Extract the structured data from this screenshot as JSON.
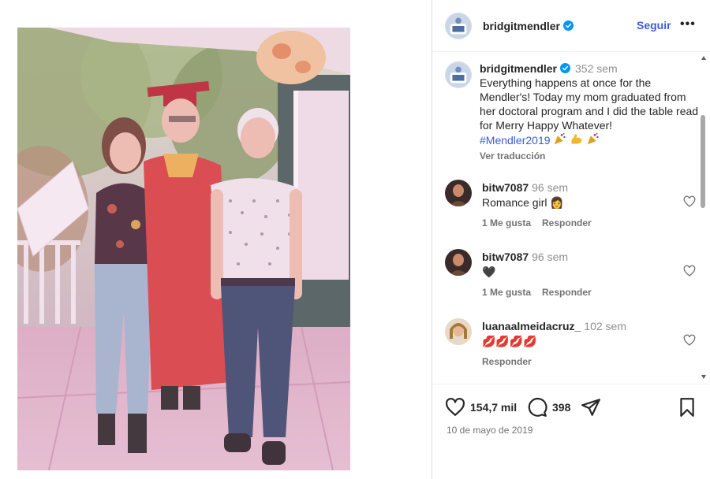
{
  "post": {
    "username": "bridgitmendler",
    "verified": true,
    "follow_label": "Seguir",
    "more_label": "•••",
    "caption": {
      "username": "bridgitmendler",
      "time_ago": "352 sem",
      "text": "Everything happens at once for the Mendler's! Today my mom graduated from her doctoral program and I did the table read for Merry Happy Whatever!",
      "hashtag": "#Mendler2019",
      "emojis": [
        "party-popper",
        "flexed-biceps",
        "party-popper"
      ],
      "translate_label": "Ver traducción"
    },
    "comments": [
      {
        "username": "bitw7087",
        "time_ago": "96 sem",
        "text": "Romance girl 👩",
        "likes_label": "1 Me gusta",
        "reply_label": "Responder"
      },
      {
        "username": "bitw7087",
        "time_ago": "96 sem",
        "text": "🖤",
        "likes_label": "1 Me gusta",
        "reply_label": "Responder"
      },
      {
        "username": "luanaalmeidacruz_",
        "time_ago": "102 sem",
        "text": "💋💋💋💋",
        "likes_label": "",
        "reply_label": "Responder"
      }
    ],
    "likes_count": "154,7 mil",
    "comments_count": "398",
    "date": "10 de mayo de 2019",
    "icons": {
      "like": "heart-icon",
      "comment": "comment-icon",
      "share": "send-icon",
      "save": "bookmark-icon",
      "verified": "verified-badge-icon"
    },
    "colors": {
      "link": "#3b5bd6",
      "verified": "#0095f6",
      "muted": "#737373",
      "text": "#262626"
    }
  }
}
